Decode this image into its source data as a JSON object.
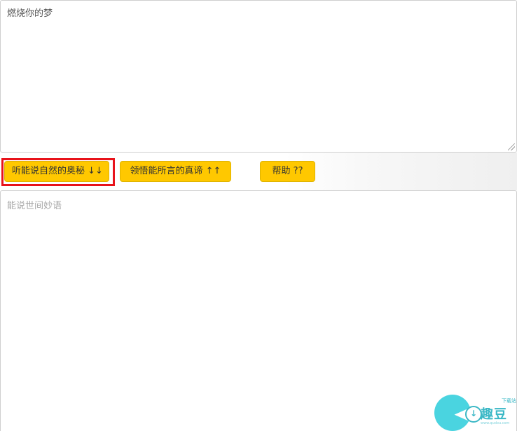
{
  "input": {
    "value": "燃烧你的梦"
  },
  "toolbar": {
    "listen_button": "听能说自然的奥秘 ↓↓",
    "speak_button": "领悟能所言的真谛 ↑↑",
    "help_button": "帮助 ??"
  },
  "output": {
    "placeholder": "能说世间妙语"
  },
  "watermark": {
    "brand": "趣豆",
    "small_text": "下载站",
    "url": "www.qudou.com",
    "accent_color": "#4ad4e0"
  },
  "colors": {
    "button_bg": "#ffc800",
    "highlight_border": "#e8131b"
  }
}
